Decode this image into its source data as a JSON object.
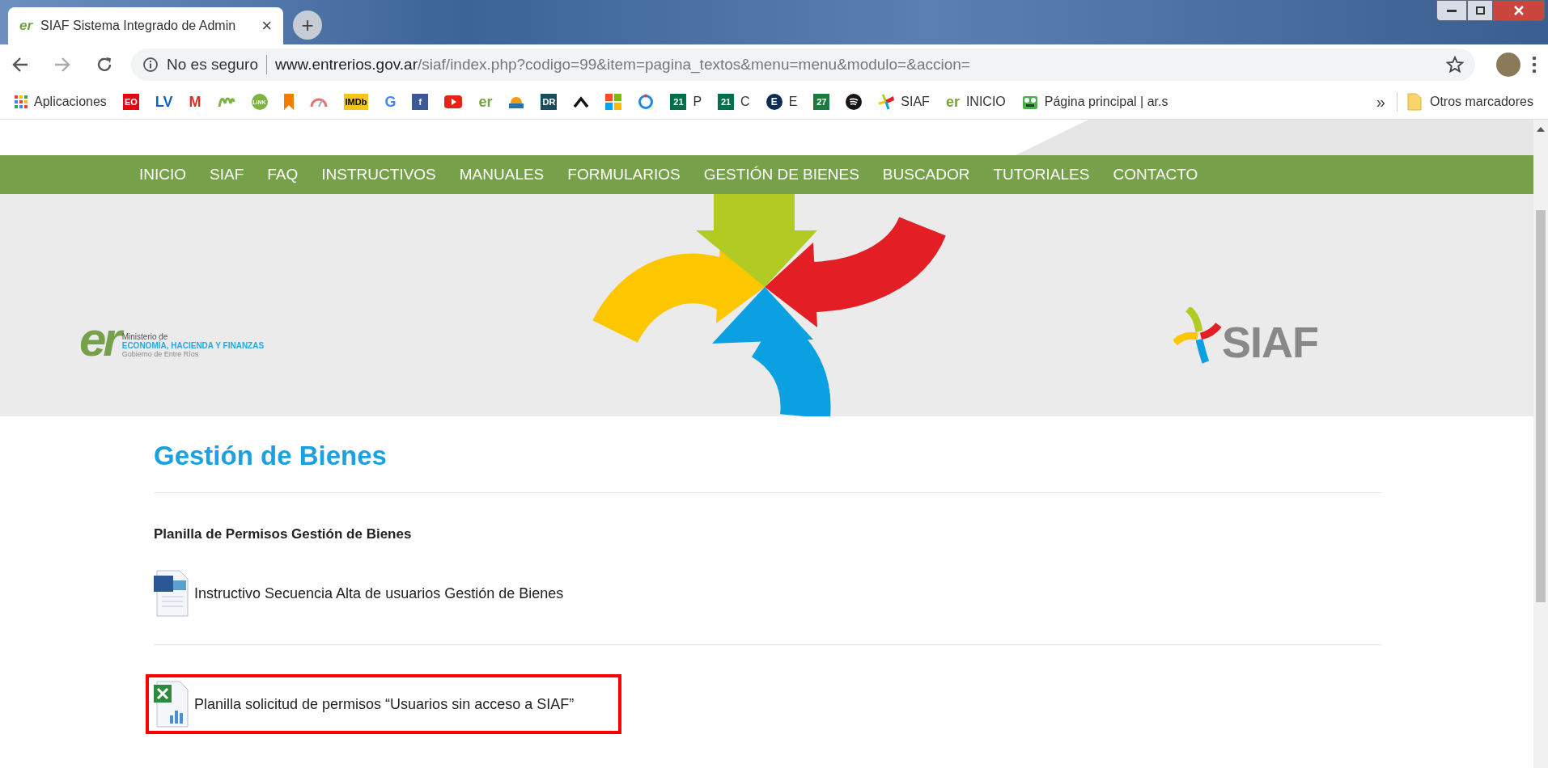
{
  "tab": {
    "favicon": "er",
    "title": "SIAF Sistema Integrado de Admin",
    "close": "×",
    "new_tab": "+"
  },
  "address_bar": {
    "security": "No es seguro",
    "host": "www.entrerios.gov.ar",
    "path": "/siaf/index.php?codigo=99&item=pagina_textos&menu=menu&modulo=&accion="
  },
  "bookmarks": [
    {
      "kind": "apps",
      "label": "Aplicaciones"
    },
    {
      "kind": "tile",
      "badge": "EO",
      "color": "#e30613"
    },
    {
      "kind": "letters",
      "badge": "LV",
      "color": "#1565c0"
    },
    {
      "kind": "letters",
      "badge": "M",
      "color": "#d93025"
    },
    {
      "kind": "wave",
      "color": "#7cb342"
    },
    {
      "kind": "disc",
      "badge": "LINK",
      "color": "#7cb342"
    },
    {
      "kind": "ribbon",
      "color": "#f57c00"
    },
    {
      "kind": "gauge",
      "color": "#e57373"
    },
    {
      "kind": "tile",
      "badge": "IMDb",
      "color": "#f5c518"
    },
    {
      "kind": "letters",
      "badge": "G",
      "color": "#4285f4"
    },
    {
      "kind": "tile",
      "badge": "f",
      "color": "#3b5998"
    },
    {
      "kind": "play",
      "color": "#e62117"
    },
    {
      "kind": "letters",
      "badge": "er",
      "color": "#7aa23f"
    },
    {
      "kind": "sunset",
      "color": "#f39c12"
    },
    {
      "kind": "tile",
      "badge": "DR",
      "color": "#1a4d5c"
    },
    {
      "kind": "chevron",
      "color": "#111111"
    },
    {
      "kind": "windows",
      "color": "#f25022"
    },
    {
      "kind": "ring",
      "color": "#1e88e5"
    },
    {
      "kind": "tile",
      "badge": "21",
      "color": "#00704a",
      "label": "P"
    },
    {
      "kind": "tile",
      "badge": "21",
      "color": "#00704a",
      "label": "C"
    },
    {
      "kind": "disc",
      "badge": "E",
      "color": "#0d2c54",
      "label": "E"
    },
    {
      "kind": "tile",
      "badge": "27",
      "color": "#1b7a3e"
    },
    {
      "kind": "spotify",
      "color": "#191414"
    },
    {
      "kind": "pinwheel",
      "color": "#e31e24",
      "label": "SIAF"
    },
    {
      "kind": "letters",
      "badge": "er",
      "color": "#7aa23f",
      "label": "INICIO"
    },
    {
      "kind": "frog",
      "color": "#4caf50",
      "label": "Página principal | ar.s"
    }
  ],
  "bookmarks_more": "»",
  "other_bookmarks": "Otros marcadores",
  "nav": [
    "INICIO",
    "SIAF",
    "FAQ",
    "INSTRUCTIVOS",
    "MANUALES",
    "FORMULARIOS",
    "GESTIÓN DE BIENES",
    "BUSCADOR",
    "TUTORIALES",
    "CONTACTO"
  ],
  "ministry_logo": {
    "mark": "er",
    "line_1": "Ministerio de",
    "line_2": "ECONOMÍA, HACIENDA Y FINANZAS",
    "line_3": "Gobierno de Entre Ríos"
  },
  "siaf_logo": {
    "text": "SIAF"
  },
  "heading": "Gestión de Bienes",
  "subheading": "Planilla de Permisos Gestión de Bienes",
  "documents": [
    {
      "kind": "word",
      "label": "Instructivo Secuencia Alta de usuarios Gestión de Bienes",
      "highlighted": false
    },
    {
      "kind": "excel",
      "label": "Planilla solicitud de permisos “Usuarios sin acceso a SIAF”",
      "highlighted": true
    }
  ]
}
